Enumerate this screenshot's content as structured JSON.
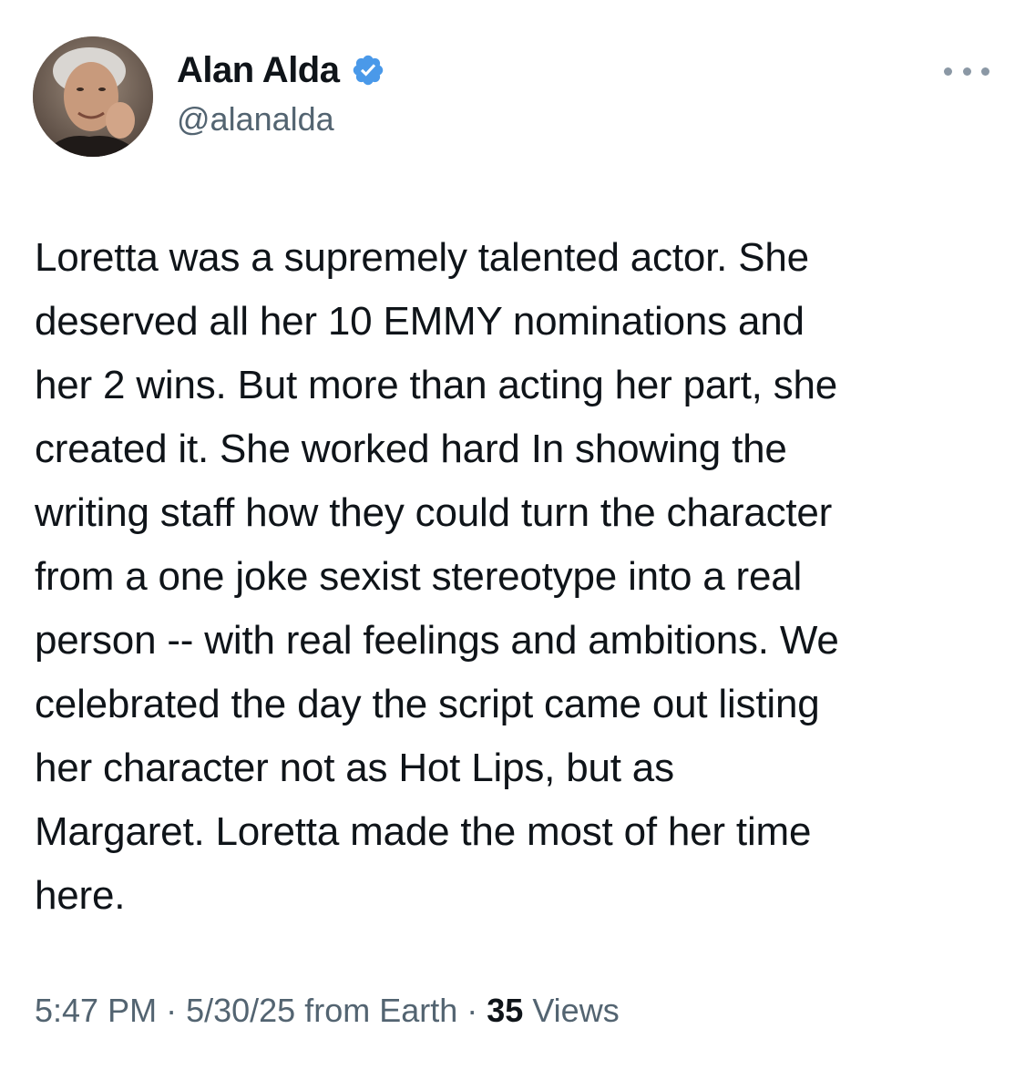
{
  "author": {
    "display_name": "Alan Alda",
    "handle": "@alanalda",
    "verified": true,
    "verified_color": "#4a99e9",
    "avatar_icon": "profile-photo-avatar"
  },
  "menu": {
    "icon": "more-horizontal-icon"
  },
  "tweet": {
    "text": "Loretta was a supremely talented actor. She\ndeserved all her 10 EMMY nominations and\nher 2 wins. But more than acting her part, she\ncreated it. She worked hard In showing  the\nwriting staff how they could turn the character\nfrom a one joke sexist stereotype into a real\nperson -- with real feelings and ambitions. We\ncelebrated the day the script came out listing\nher character not as Hot Lips, but as\nMargaret.  Loretta made  the most of her time\nhere."
  },
  "meta": {
    "time": "5:47 PM",
    "separator": " · ",
    "date": "5/30/25",
    "source": " from Earth",
    "views_count": "35",
    "views_label": " Views"
  },
  "colors": {
    "text_primary": "#0f1419",
    "text_secondary": "#536471"
  }
}
